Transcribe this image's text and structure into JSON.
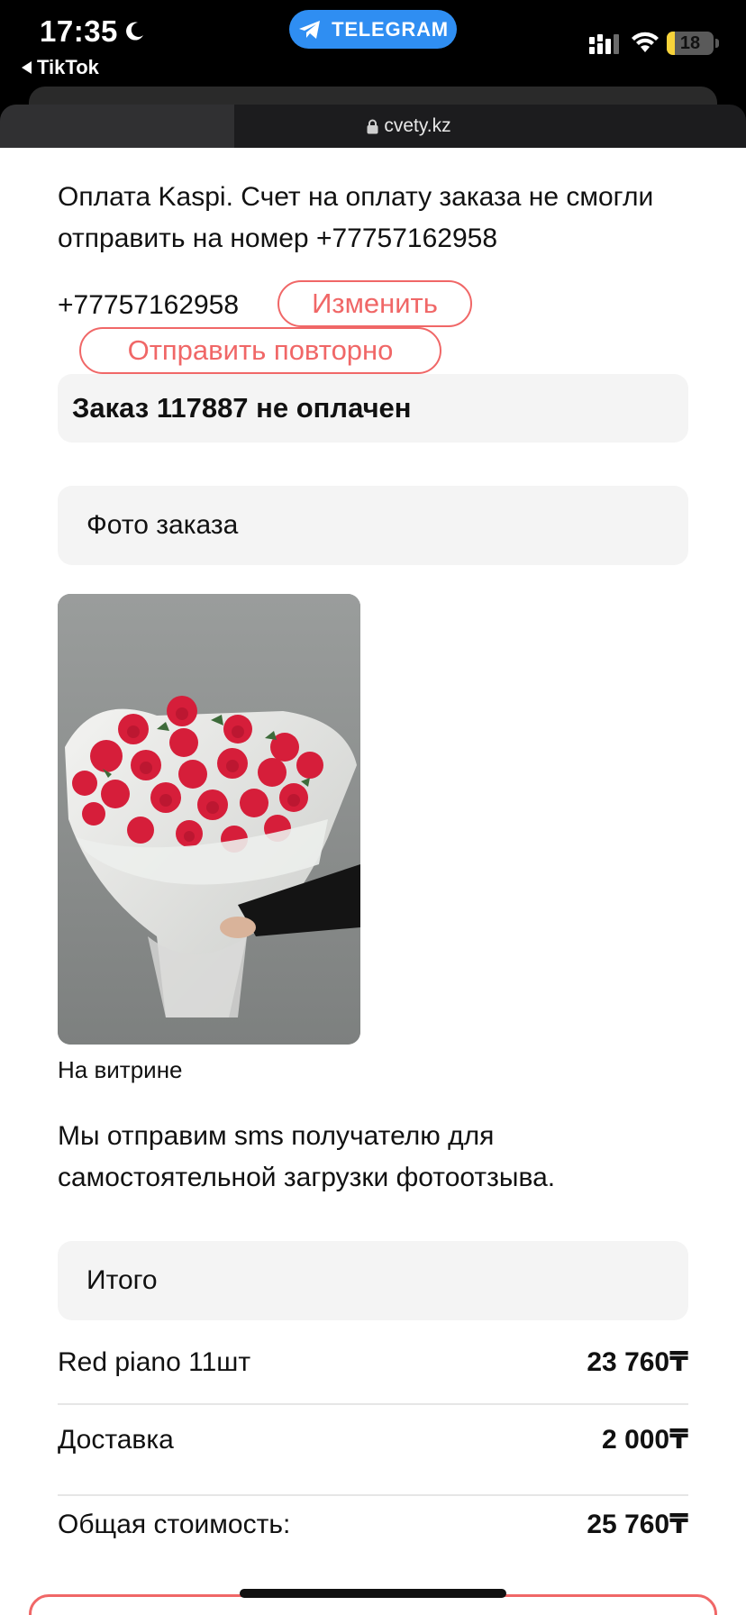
{
  "status_bar": {
    "time": "17:35",
    "back_app": "TikTok",
    "pill_label": "TELEGRAM",
    "battery_level": "18",
    "battery_fraction": 0.18,
    "accent": "#2f8ef2"
  },
  "browser": {
    "url": "cvety.kz"
  },
  "page": {
    "notice": "Оплата Kaspi. Счет на оплату заказа не смогли отправить на номер +77757162958",
    "phone": "+77757162958",
    "change_button": "Изменить",
    "resend_button": "Отправить повторно",
    "order_status": "Заказ 117887 не оплачен",
    "photo_header": "Фото заказа",
    "photo_caption": "На витрине",
    "sms_note": "Мы отправим sms получателю для самостоятельной загрузки фотоотзыва.",
    "total_header": "Итого",
    "summary": [
      {
        "label": "Red piano 11шт",
        "value": "23 760₸"
      },
      {
        "label": "Доставка",
        "value": "2 000₸"
      },
      {
        "label": "Общая стоимость:",
        "value": "25 760₸"
      }
    ],
    "accent": "#f06767"
  },
  "icons": [
    "moon-icon",
    "telegram-icon",
    "back-arrow-icon",
    "signal-icon",
    "wifi-icon",
    "battery-icon",
    "lock-icon"
  ]
}
